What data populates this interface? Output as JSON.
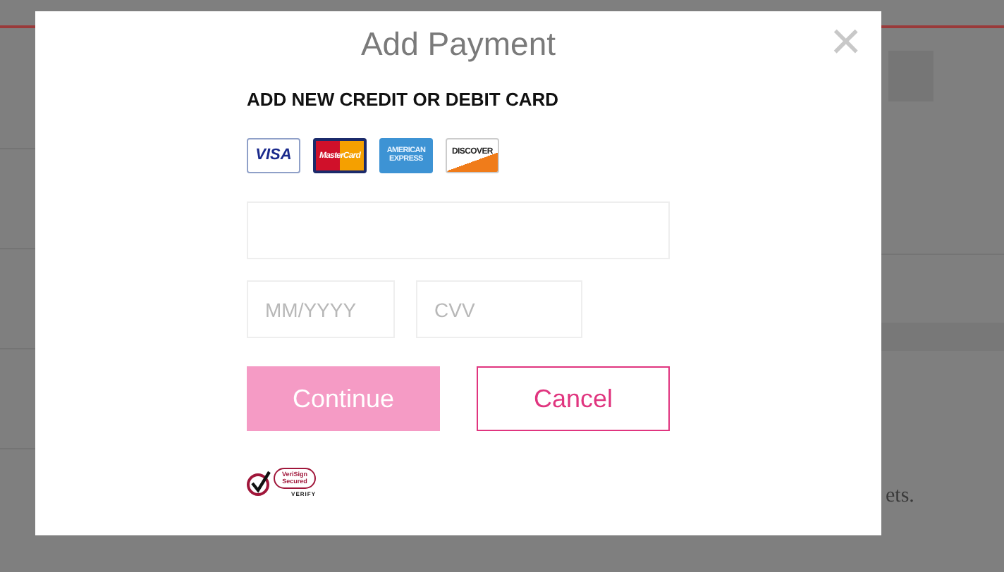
{
  "background": {
    "text_fragment": "ets."
  },
  "dialog": {
    "title": "Add Payment",
    "close": "×",
    "heading": "ADD NEW CREDIT OR DEBIT CARD",
    "cards": [
      {
        "kind": "visa",
        "label": "VISA"
      },
      {
        "kind": "mastercard",
        "label": "MasterCard"
      },
      {
        "kind": "amex",
        "label": "AMERICAN EXPRESS"
      },
      {
        "kind": "discover",
        "label": "DISCOVER"
      }
    ],
    "fields": [
      {
        "kind": "wide"
      },
      {
        "kind": "short",
        "placeholder": "MM/YYYY"
      },
      {
        "kind": "short",
        "placeholder": "CVV"
      }
    ],
    "buttons": [
      {
        "kind": "primary",
        "label": "Continue"
      },
      {
        "kind": "secondary",
        "label": "Cancel"
      }
    ],
    "seal": {
      "label": "VeriSign Secured",
      "caption": "VERIFY"
    }
  }
}
